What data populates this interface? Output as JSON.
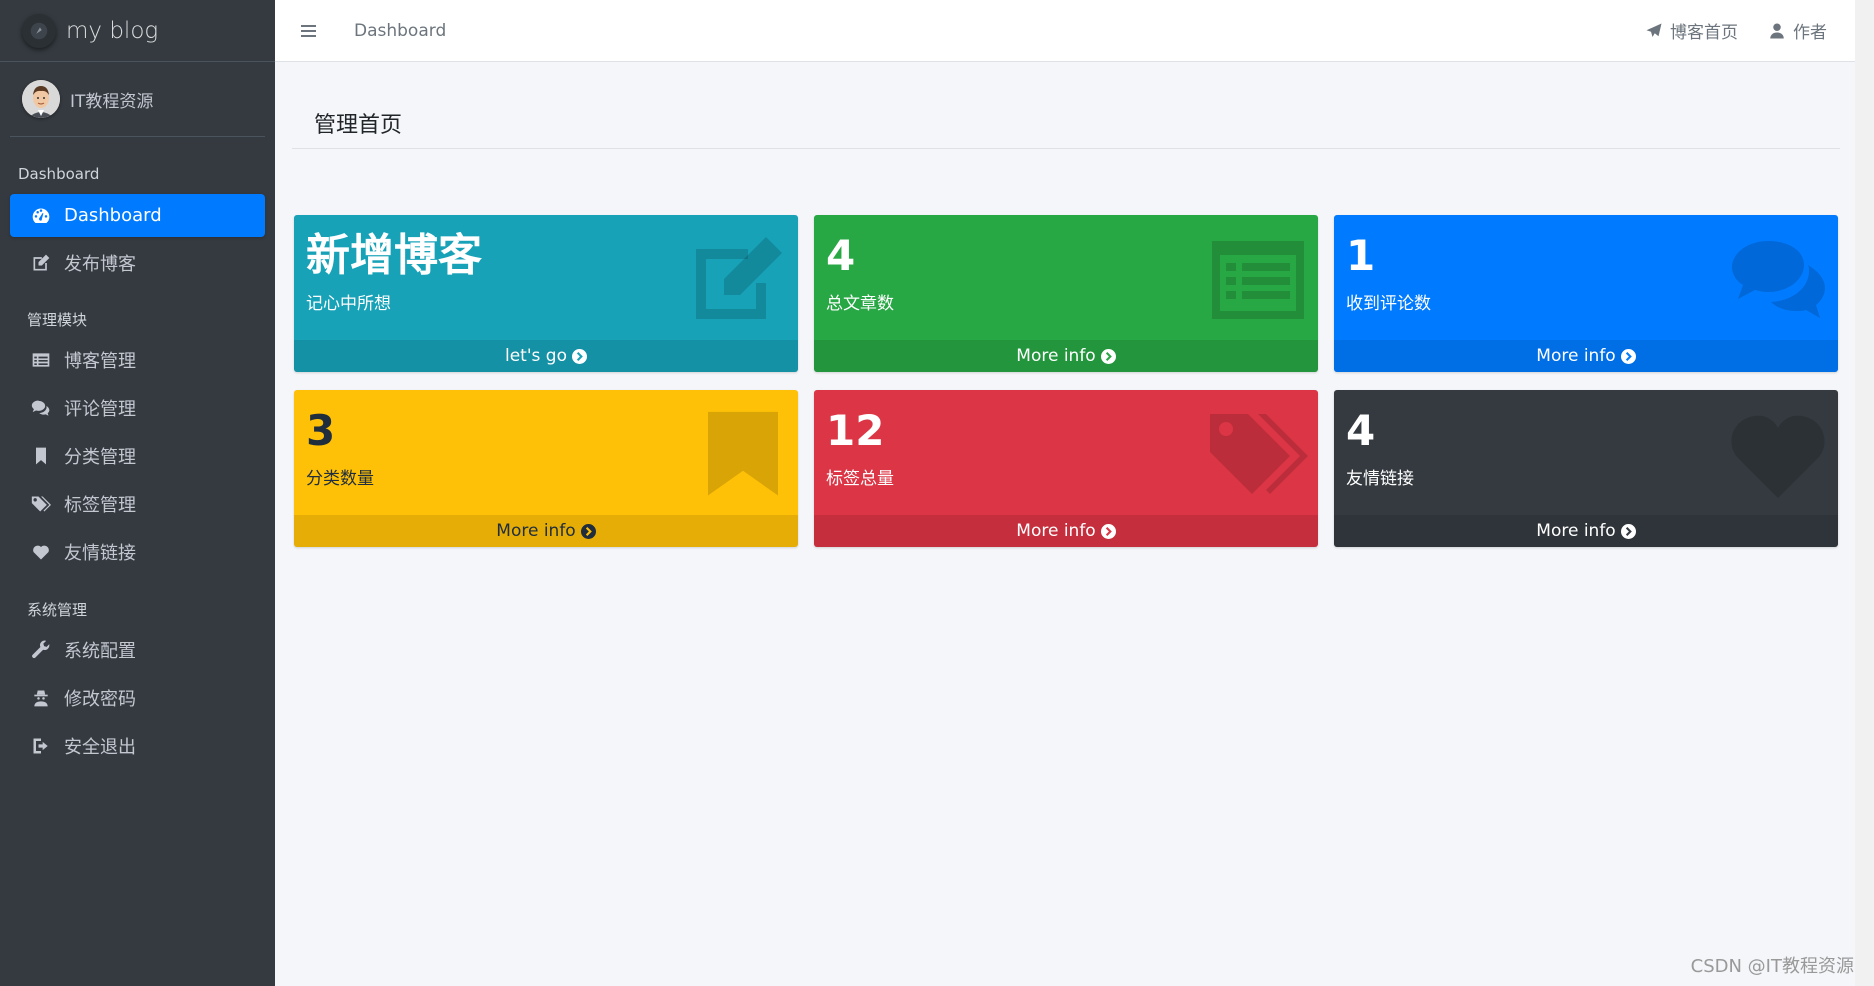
{
  "brand": {
    "name": "my blog"
  },
  "user": {
    "name": "IT教程资源"
  },
  "sidebar": {
    "section_dashboard": "Dashboard",
    "section_manage": "管理模块",
    "section_system": "系统管理",
    "items": [
      {
        "label": "Dashboard",
        "icon": "dashboard-icon",
        "active": true
      },
      {
        "label": "发布博客",
        "icon": "edit-icon"
      },
      {
        "label": "博客管理",
        "icon": "list-icon"
      },
      {
        "label": "评论管理",
        "icon": "comments-icon"
      },
      {
        "label": "分类管理",
        "icon": "bookmark-icon"
      },
      {
        "label": "标签管理",
        "icon": "tags-icon"
      },
      {
        "label": "友情链接",
        "icon": "heart-icon"
      },
      {
        "label": "系统配置",
        "icon": "wrench-icon"
      },
      {
        "label": "修改密码",
        "icon": "user-secret-icon"
      },
      {
        "label": "安全退出",
        "icon": "sign-out-icon"
      }
    ]
  },
  "header": {
    "breadcrumb": "Dashboard",
    "blog_home": "博客首页",
    "author": "作者"
  },
  "page": {
    "title": "管理首页"
  },
  "cards": [
    {
      "value": "新增博客",
      "label": "记心中所想",
      "footer": "let's go",
      "color": "#17a2b8",
      "icon": "edit-icon"
    },
    {
      "value": "4",
      "label": "总文章数",
      "footer": "More info",
      "color": "#28a745",
      "icon": "list-alt-icon"
    },
    {
      "value": "1",
      "label": "收到评论数",
      "footer": "More info",
      "color": "#007bff",
      "icon": "comments-icon"
    },
    {
      "value": "3",
      "label": "分类数量",
      "footer": "More info",
      "color": "#ffc107",
      "icon": "bookmark-icon"
    },
    {
      "value": "12",
      "label": "标签总量",
      "footer": "More info",
      "color": "#dc3545",
      "icon": "tags-icon"
    },
    {
      "value": "4",
      "label": "友情链接",
      "footer": "More info",
      "color": "#343a40",
      "icon": "heart-icon"
    }
  ],
  "watermark": "CSDN @IT教程资源"
}
